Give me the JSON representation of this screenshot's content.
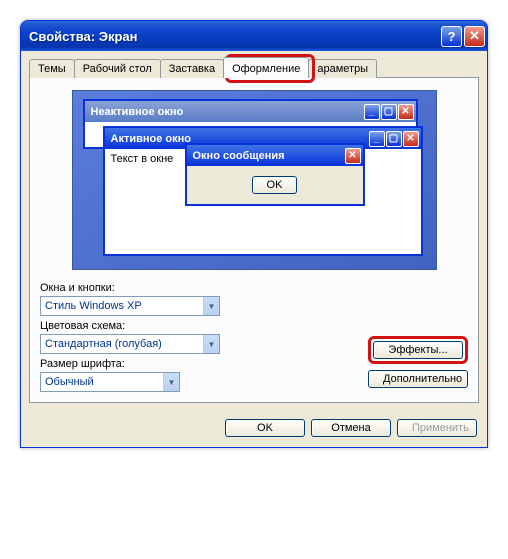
{
  "title": "Свойства: Экран",
  "tabs": [
    "Темы",
    "Рабочий стол",
    "Заставка",
    "Оформление",
    "араметры"
  ],
  "active_tab_index": 3,
  "preview": {
    "inactive_title": "Неактивное окно",
    "active_title": "Активное окно",
    "text": "Текст в окне",
    "msg_title": "Окно сообщения",
    "msg_ok": "OK"
  },
  "labels": {
    "windows_buttons": "Окна и кнопки:",
    "color_scheme": "Цветовая схема:",
    "font_size": "Размер шрифта:"
  },
  "combos": {
    "style": "Стиль Windows XP",
    "color": "Стандартная (голубая)",
    "font": "Обычный"
  },
  "side_buttons": {
    "effects": "Эффекты...",
    "advanced": "Дополнительно"
  },
  "bottom": {
    "ok": "OK",
    "cancel": "Отмена",
    "apply": "Применить"
  },
  "icons": {
    "help": "?",
    "close": "✕",
    "min": "_",
    "max": "▢",
    "down": "▼"
  }
}
